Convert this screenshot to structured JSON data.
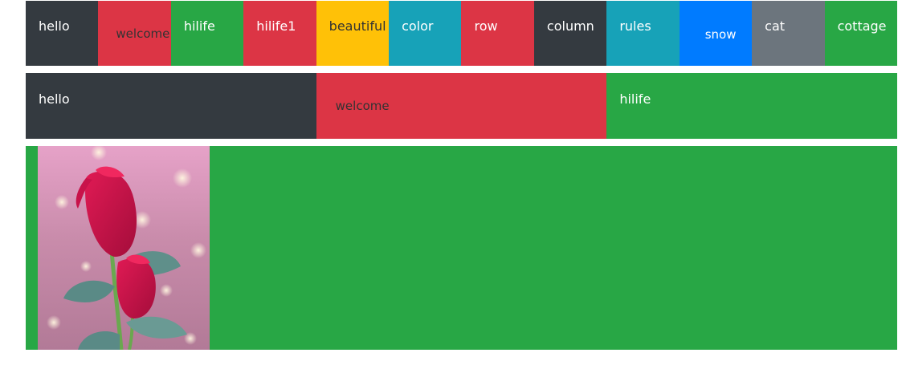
{
  "colors": {
    "dark": "#343a40",
    "danger": "#dc3545",
    "success": "#28a745",
    "warning": "#ffc107",
    "info": "#17a2b8",
    "primary": "#007bff",
    "secondary": "#6c757d"
  },
  "row1": {
    "items": [
      {
        "label": "hello"
      },
      {
        "label": "welcome"
      },
      {
        "label": "hilife"
      },
      {
        "label": "hilife1"
      },
      {
        "label": "beautiful"
      },
      {
        "label": "color"
      },
      {
        "label": "row"
      },
      {
        "label": "column"
      },
      {
        "label": "rules"
      },
      {
        "label": "snow"
      },
      {
        "label": "cat"
      },
      {
        "label": "cottage"
      }
    ]
  },
  "row2": {
    "items": [
      {
        "label": "hello"
      },
      {
        "label": "welcome"
      },
      {
        "label": "hilife"
      }
    ]
  },
  "row3": {
    "image": {
      "icon": "rose-photo"
    }
  }
}
